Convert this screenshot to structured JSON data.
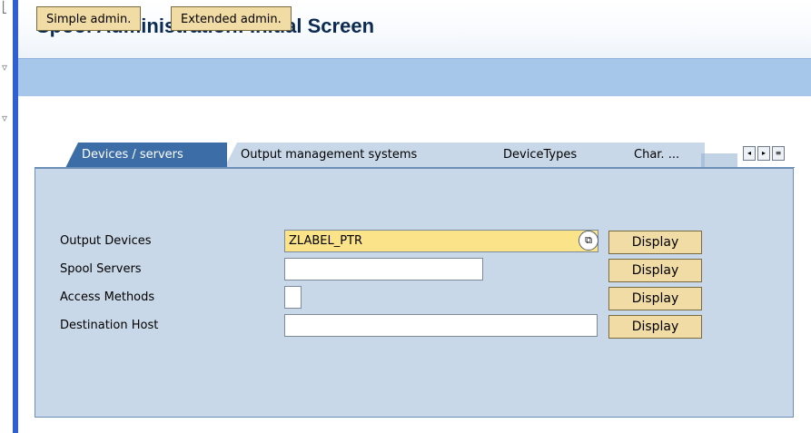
{
  "window": {
    "title": "Spool Administration: Initial Screen"
  },
  "toolbar": {
    "simple_admin_label": "Simple admin.",
    "extended_admin_label": "Extended admin."
  },
  "tabs": [
    {
      "label": "Devices / servers",
      "active": true
    },
    {
      "label": "Output management systems",
      "active": false
    },
    {
      "label": "DeviceTypes",
      "active": false
    },
    {
      "label": "Char. ...",
      "active": false
    }
  ],
  "tab_nav": {
    "left_glyph": "◂",
    "right_glyph": "▸",
    "list_glyph": "≡"
  },
  "form": {
    "output_devices": {
      "label": "Output Devices",
      "value": "ZLABEL_PTR",
      "help_glyph": "⧉",
      "button": "Display"
    },
    "spool_servers": {
      "label": "Spool Servers",
      "value": "",
      "button": "Display"
    },
    "access_methods": {
      "label": "Access Methods",
      "value": "",
      "button": "Display"
    },
    "destination_host": {
      "label": "Destination Host",
      "value": "",
      "button": "Display"
    }
  },
  "colors": {
    "title": "#0a2a52",
    "toolbar_bg": "#a7c7ea",
    "button_bg": "#f2dca6",
    "tab_active": "#3d6da6",
    "panel_bg": "#c9d8e8",
    "required_field": "#fbe38a",
    "left_accent": "#2f5fd0"
  }
}
